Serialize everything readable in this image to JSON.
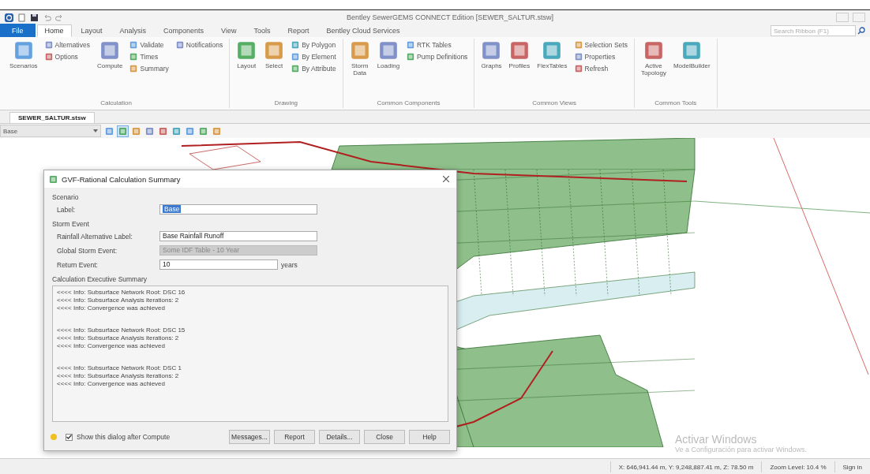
{
  "window": {
    "title": "Bentley SewerGEMS CONNECT Edition [SEWER_SALTUR.stsw]"
  },
  "menu_tabs": [
    {
      "label": "File",
      "selected": false,
      "kind": "file"
    },
    {
      "label": "Home",
      "selected": true,
      "kind": "tab"
    },
    {
      "label": "Layout",
      "selected": false,
      "kind": "tab"
    },
    {
      "label": "Analysis",
      "selected": false,
      "kind": "tab"
    },
    {
      "label": "Components",
      "selected": false,
      "kind": "tab"
    },
    {
      "label": "View",
      "selected": false,
      "kind": "tab"
    },
    {
      "label": "Tools",
      "selected": false,
      "kind": "tab"
    },
    {
      "label": "Report",
      "selected": false,
      "kind": "tab"
    },
    {
      "label": "Bentley Cloud Services",
      "selected": false,
      "kind": "tab"
    }
  ],
  "search": {
    "placeholder": "Search Ribbon (F1)"
  },
  "ribbon_groups": [
    {
      "label": "Calculation",
      "items": [
        {
          "label": "Scenarios",
          "kind": "large"
        },
        {
          "label": "Alternatives",
          "kind": "small"
        },
        {
          "label": "Options",
          "kind": "small"
        },
        {
          "label": "Compute",
          "kind": "large"
        },
        {
          "label": "Validate",
          "kind": "small"
        },
        {
          "label": "Times",
          "kind": "small"
        },
        {
          "label": "Summary",
          "kind": "small"
        },
        {
          "label": "Notifications",
          "kind": "small"
        }
      ]
    },
    {
      "label": "Drawing",
      "items": [
        {
          "label": "Layout",
          "kind": "large"
        },
        {
          "label": "Select",
          "kind": "large"
        },
        {
          "label": "By Polygon",
          "kind": "small"
        },
        {
          "label": "By Element",
          "kind": "small"
        },
        {
          "label": "By Attribute",
          "kind": "small"
        }
      ]
    },
    {
      "label": "Common Components",
      "items": [
        {
          "label": "Storm Data",
          "kind": "large"
        },
        {
          "label": "Loading",
          "kind": "large"
        },
        {
          "label": "RTK Tables",
          "kind": "small"
        },
        {
          "label": "Pump Definitions",
          "kind": "small"
        }
      ]
    },
    {
      "label": "Common Views",
      "items": [
        {
          "label": "Graphs",
          "kind": "large"
        },
        {
          "label": "Profiles",
          "kind": "large"
        },
        {
          "label": "FlexTables",
          "kind": "large"
        },
        {
          "label": "Selection Sets",
          "kind": "small"
        },
        {
          "label": "Properties",
          "kind": "small"
        },
        {
          "label": "Refresh",
          "kind": "small"
        }
      ]
    },
    {
      "label": "Common Tools",
      "items": [
        {
          "label": "Active Topology",
          "kind": "large"
        },
        {
          "label": "ModelBuilder",
          "kind": "large"
        }
      ]
    }
  ],
  "document_tab": {
    "label": "SEWER_SALTUR.stsw"
  },
  "scenario_select": {
    "value": "Base"
  },
  "dialog": {
    "title": "GVF-Rational Calculation Summary",
    "scenario_section": "Scenario",
    "fields": [
      {
        "label": "Label:",
        "value": "Base",
        "kind": "selected"
      }
    ],
    "storm_section": "Storm Event",
    "storm_fields": [
      {
        "label": "Rainfall Alternative Label:",
        "value": "Base Rainfall Runoff",
        "disabled": false
      },
      {
        "label": "Global Storm Event:",
        "value": "Some IDF Table - 10 Year",
        "disabled": true
      },
      {
        "label": "Return Event:",
        "value": "10",
        "disabled": false,
        "unit": "years"
      }
    ],
    "summary_section": "Calculation Executive Summary",
    "summary_blocks": [
      [
        "<<<< Info: Subsurface Network Root: DSC 16",
        "<<<< Info: Subsurface Analysis iterations: 2",
        "<<<< Info: Convergence was achieved"
      ],
      [
        "<<<< Info: Subsurface Network Root: DSC 15",
        "<<<< Info: Subsurface Analysis iterations: 2",
        "<<<< Info: Convergence was achieved"
      ],
      [
        "<<<< Info: Subsurface Network Root: DSC 1",
        "<<<< Info: Subsurface Analysis iterations: 2",
        "<<<< Info: Convergence was achieved"
      ]
    ],
    "show_after_compute": {
      "label": "Show this dialog after Compute",
      "checked": true
    },
    "buttons": [
      "Messages...",
      "Report",
      "Details...",
      "Close",
      "Help"
    ]
  },
  "activation_notice": {
    "title": "Activar Windows",
    "text": "Ve a Configuración para activar Windows."
  },
  "status_bar": {
    "coordinates": "X: 646,941.44 m, Y: 9,248,887.41 m, Z: 78.50 m",
    "zoom": "Zoom Level: 10.4 %",
    "sign_in": "Sign in"
  }
}
